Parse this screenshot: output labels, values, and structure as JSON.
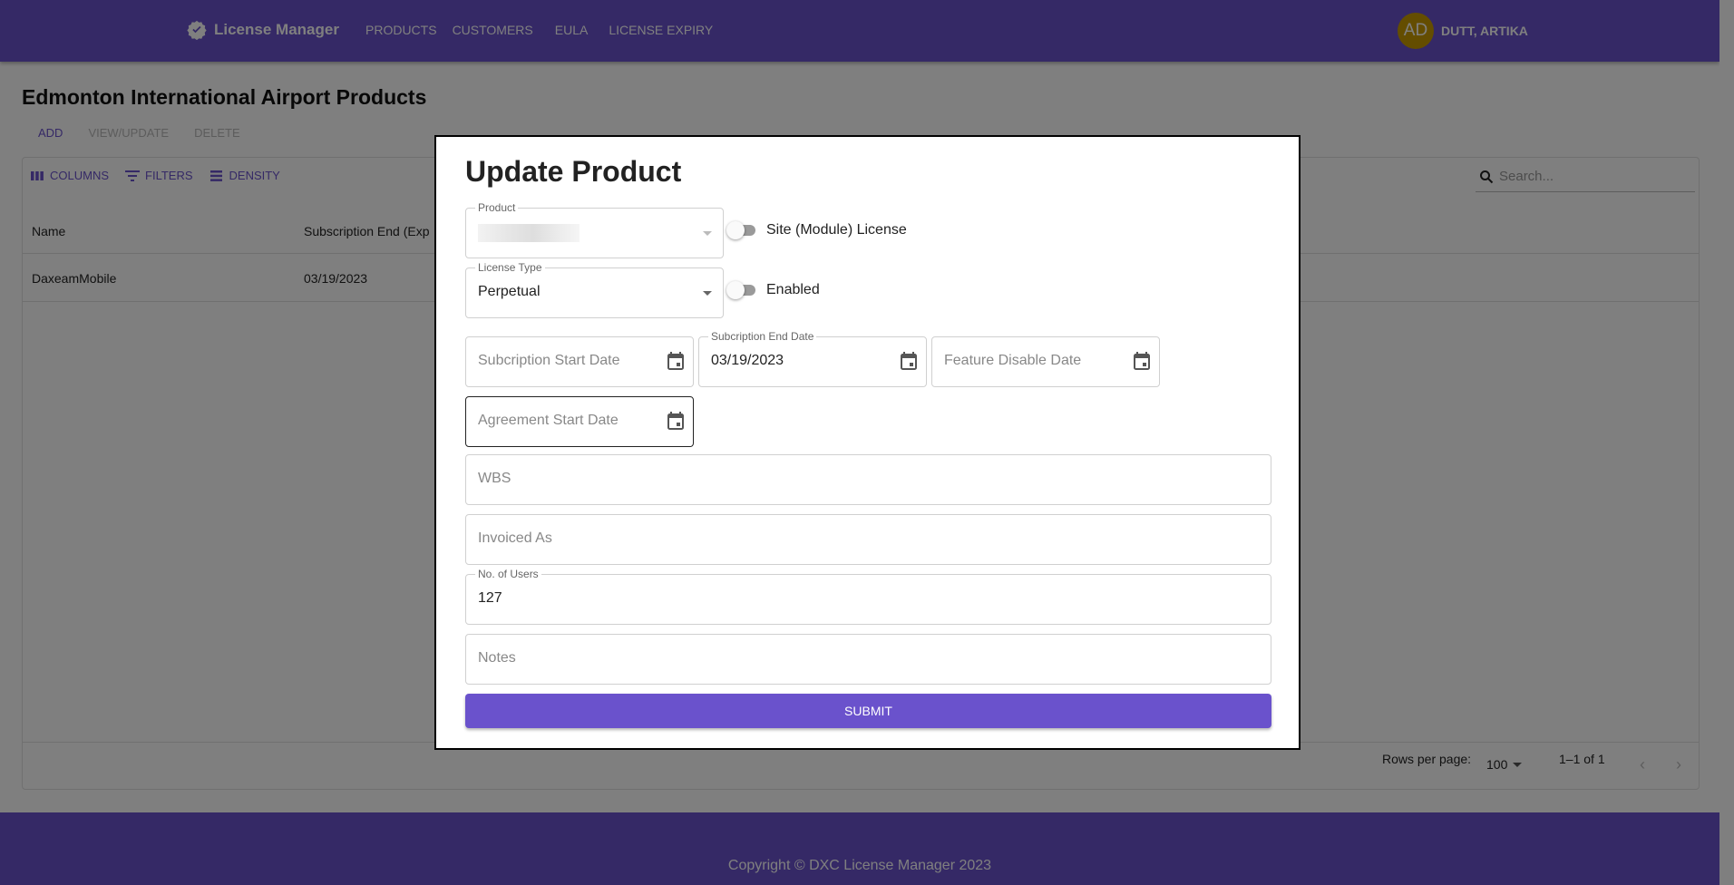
{
  "app": {
    "brand": "License Manager",
    "nav": [
      "PRODUCTS",
      "CUSTOMERS",
      "EULA",
      "LICENSE EXPIRY"
    ],
    "user": {
      "initials": "AD",
      "name": "DUTT, ARTIKA"
    },
    "colors": {
      "primary": "#6a52cc",
      "avatar": "#c89b00"
    }
  },
  "page": {
    "title": "Edmonton International Airport Products",
    "actions": {
      "add": "ADD",
      "view_update": "VIEW/UPDATE",
      "delete": "DELETE"
    }
  },
  "grid": {
    "toolbar": {
      "columns": "COLUMNS",
      "filters": "FILTERS",
      "density": "DENSITY"
    },
    "search_placeholder": "Search...",
    "columns": [
      "Name",
      "Subscription End (Exp"
    ],
    "rows": [
      {
        "name": "DaxeamMobile",
        "subscription_end": "03/19/2023"
      }
    ],
    "footer": {
      "rows_per_page_label": "Rows per page:",
      "rows_per_page_value": "100",
      "range": "1–1 of 1"
    }
  },
  "footer": {
    "copyright": "Copyright © DXC License Manager 2023"
  },
  "modal": {
    "title": "Update Product",
    "product": {
      "label": "Product",
      "value": ""
    },
    "site_license": {
      "label": "Site (Module) License",
      "checked": false
    },
    "license_type": {
      "label": "License Type",
      "value": "Perpetual"
    },
    "enabled": {
      "label": "Enabled",
      "checked": false
    },
    "subscription_start": {
      "placeholder": "Subcription Start Date",
      "value": ""
    },
    "subscription_end": {
      "label": "Subcription End Date",
      "value": "03/19/2023"
    },
    "feature_disable": {
      "placeholder": "Feature Disable Date",
      "value": ""
    },
    "agreement_start": {
      "placeholder": "Agreement Start Date",
      "value": ""
    },
    "wbs": {
      "placeholder": "WBS",
      "value": ""
    },
    "invoiced_as": {
      "placeholder": "Invoiced As",
      "value": ""
    },
    "users": {
      "label": "No. of Users",
      "value": "127"
    },
    "notes": {
      "placeholder": "Notes",
      "value": ""
    },
    "submit": "SUBMIT"
  }
}
